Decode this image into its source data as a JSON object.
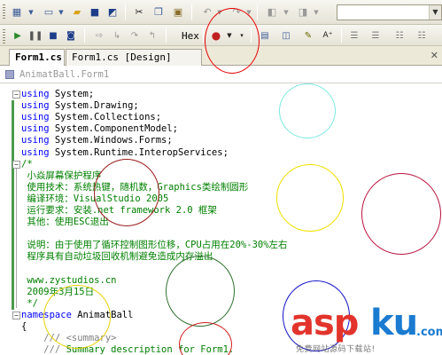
{
  "toolbar_top": {
    "icons": [
      "grid-icon",
      "new-file-icon",
      "open-icon",
      "save-icon",
      "save-all-icon",
      "cut-icon",
      "copy-icon",
      "paste-icon",
      "undo-icon",
      "redo-icon",
      "nav-back-icon",
      "nav-forward-icon"
    ],
    "search_combo": ""
  },
  "toolbar_debug": {
    "hex_label": "Hex",
    "icons": [
      "start-icon",
      "pause-icon",
      "stop-icon",
      "restart-icon",
      "show-next-statement-icon",
      "step-into-icon",
      "step-over-icon",
      "step-out-icon",
      "breakpoint-icon"
    ]
  },
  "tabs": [
    {
      "label": "Form1.cs",
      "active": true
    },
    {
      "label": "Form1.cs [Design]",
      "active": false
    }
  ],
  "navbar": {
    "text": "AnimatBall.Form1"
  },
  "code": [
    [
      {
        "c": "kw",
        "t": "using"
      },
      {
        "c": "",
        "t": " System;"
      }
    ],
    [
      {
        "c": "kw",
        "t": "using"
      },
      {
        "c": "",
        "t": " System.Drawing;"
      }
    ],
    [
      {
        "c": "kw",
        "t": "using"
      },
      {
        "c": "",
        "t": " System.Collections;"
      }
    ],
    [
      {
        "c": "kw",
        "t": "using"
      },
      {
        "c": "",
        "t": " System.ComponentModel;"
      }
    ],
    [
      {
        "c": "kw",
        "t": "using"
      },
      {
        "c": "",
        "t": " System.Windows.Forms;"
      }
    ],
    [
      {
        "c": "kw",
        "t": "using"
      },
      {
        "c": "",
        "t": " System.Runtime.InteropServices;"
      }
    ],
    [
      {
        "c": "cm",
        "t": "/*"
      }
    ],
    [
      {
        "c": "cm",
        "t": " 小焱屏幕保护程序"
      }
    ],
    [
      {
        "c": "cm",
        "t": " 使用技术：系统热键，随机数，Graphics类绘制圆形"
      }
    ],
    [
      {
        "c": "cm",
        "t": " 编译环境：VisualStudio 2005"
      }
    ],
    [
      {
        "c": "cm",
        "t": " 运行要求：安装.net framework 2.0 框架"
      }
    ],
    [
      {
        "c": "cm",
        "t": " 其他：使用ESC退出"
      }
    ],
    [
      {
        "c": "cm",
        "t": ""
      }
    ],
    [
      {
        "c": "cm",
        "t": " 说明：由于使用了循环控制图形位移，CPU占用在20%-30%左右"
      }
    ],
    [
      {
        "c": "cm",
        "t": " 程序具有自动垃圾回收机制避免造成内存溢出"
      }
    ],
    [
      {
        "c": "cm",
        "t": ""
      }
    ],
    [
      {
        "c": "cm",
        "t": " www.zystudios.cn"
      }
    ],
    [
      {
        "c": "cm",
        "t": " 2009年3月15日"
      }
    ],
    [
      {
        "c": "cm",
        "t": " */"
      }
    ],
    [
      {
        "c": "kw",
        "t": "namespace"
      },
      {
        "c": "",
        "t": " AnimatBall"
      }
    ],
    [
      {
        "c": "",
        "t": "{"
      }
    ],
    [
      {
        "c": "gr",
        "t": "    /// "
      },
      {
        "c": "gr",
        "t": "<summary>"
      }
    ],
    [
      {
        "c": "gr",
        "t": "    /// "
      },
      {
        "c": "cm",
        "t": "Summary description for Form1."
      }
    ]
  ],
  "circles": [
    {
      "color": "#e60000"
    },
    {
      "color": "#7de8e0"
    },
    {
      "color": "#9b1c1c"
    },
    {
      "color": "#f0e000"
    },
    {
      "color": "#b8123c"
    },
    {
      "color": "#2f6f2f"
    },
    {
      "color": "#1010c8"
    },
    {
      "color": "#e8d000"
    },
    {
      "color": "#d02020"
    }
  ],
  "watermark": {
    "asp": "asp",
    "ku": "ku",
    "com": ".com",
    "sub": "免费网站源码下载站!"
  },
  "colors": {
    "keyword": "#0000ff",
    "comment": "#008000",
    "xml_doc": "#808080",
    "change_bar": "#4c9a4c"
  }
}
